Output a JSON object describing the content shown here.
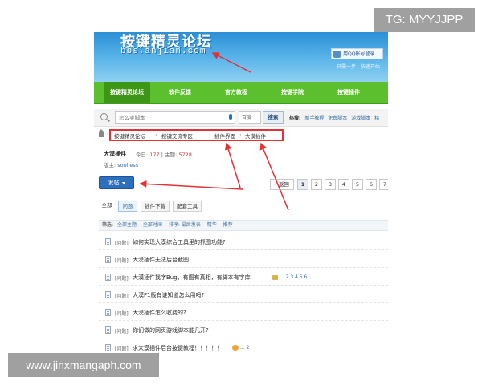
{
  "watermarks": {
    "top_right": "TG: MYYJJPP",
    "bottom_left": "www.jinxmangaph.com"
  },
  "header": {
    "logo_title": "按键精灵论坛",
    "logo_domain": "bbs.anjian.com",
    "qq_login": "用QQ帐号登录",
    "qq_sub": "只需一步，快速开始"
  },
  "nav": {
    "items": [
      {
        "label": "按键精灵论坛",
        "active": true
      },
      {
        "label": "软件反馈",
        "active": false
      },
      {
        "label": "官方教程",
        "active": false
      },
      {
        "label": "按键学院",
        "active": false
      },
      {
        "label": "按键插件",
        "active": false
      }
    ]
  },
  "search": {
    "placeholder": "怎么卖脚本",
    "engine": "百度",
    "button": "搜索",
    "hot_label": "热搜:",
    "hot_items": [
      "新手教程",
      "免费脚本",
      "游戏脚本",
      "精"
    ]
  },
  "breadcrumb": {
    "items": [
      "按键精灵论坛",
      "按键交流专区",
      "插件界面",
      "大漠插件"
    ]
  },
  "forum": {
    "title": "大漠插件",
    "today_label": "今日:",
    "today_count": "177",
    "threads_label": "主题:",
    "threads_count": "5728",
    "moderator_label": "版主:",
    "moderator": "soulless"
  },
  "post_button": "发帖",
  "pager": {
    "back": "返回",
    "pages": [
      "1",
      "2",
      "3",
      "4",
      "5",
      "6",
      "7"
    ],
    "current": "1"
  },
  "tabs": [
    "全部",
    "问题",
    "插件下载",
    "配套工具"
  ],
  "filter": {
    "label": "筛选:",
    "items": [
      "全部主题",
      "全部时间",
      "排序: 最后发表",
      "精华",
      "推荐"
    ]
  },
  "threads": [
    {
      "prefix": "[问题]",
      "title": "如何实现大漠综合工具里的抓图功能?",
      "pages": ""
    },
    {
      "prefix": "[问题]",
      "title": "大漠插件无法后台截图",
      "pages": ""
    },
    {
      "prefix": "[问题]",
      "title": "大漠插件找字Bug，有图有真相，有脚本有字库",
      "pages": "... 2 3 4 5 6",
      "mark": "img"
    },
    {
      "prefix": "[问题]",
      "title": "大漠F1版有谁知道怎么用吗?",
      "pages": ""
    },
    {
      "prefix": "[问题]",
      "title": "大漠插件怎么收费的?",
      "pages": ""
    },
    {
      "prefix": "[问题]",
      "title": "你们做的网页游戏脚本能几开?",
      "pages": ""
    },
    {
      "prefix": "[问题]",
      "title": "求大漠插件后台按键教程！！！！！",
      "pages": "... 2",
      "mark": "hot"
    }
  ],
  "colors": {
    "header_blue": "#2b8fd6",
    "nav_green": "#5bbf2e",
    "annotation_red": "#e53036",
    "post_button_blue": "#2e6fbd"
  }
}
